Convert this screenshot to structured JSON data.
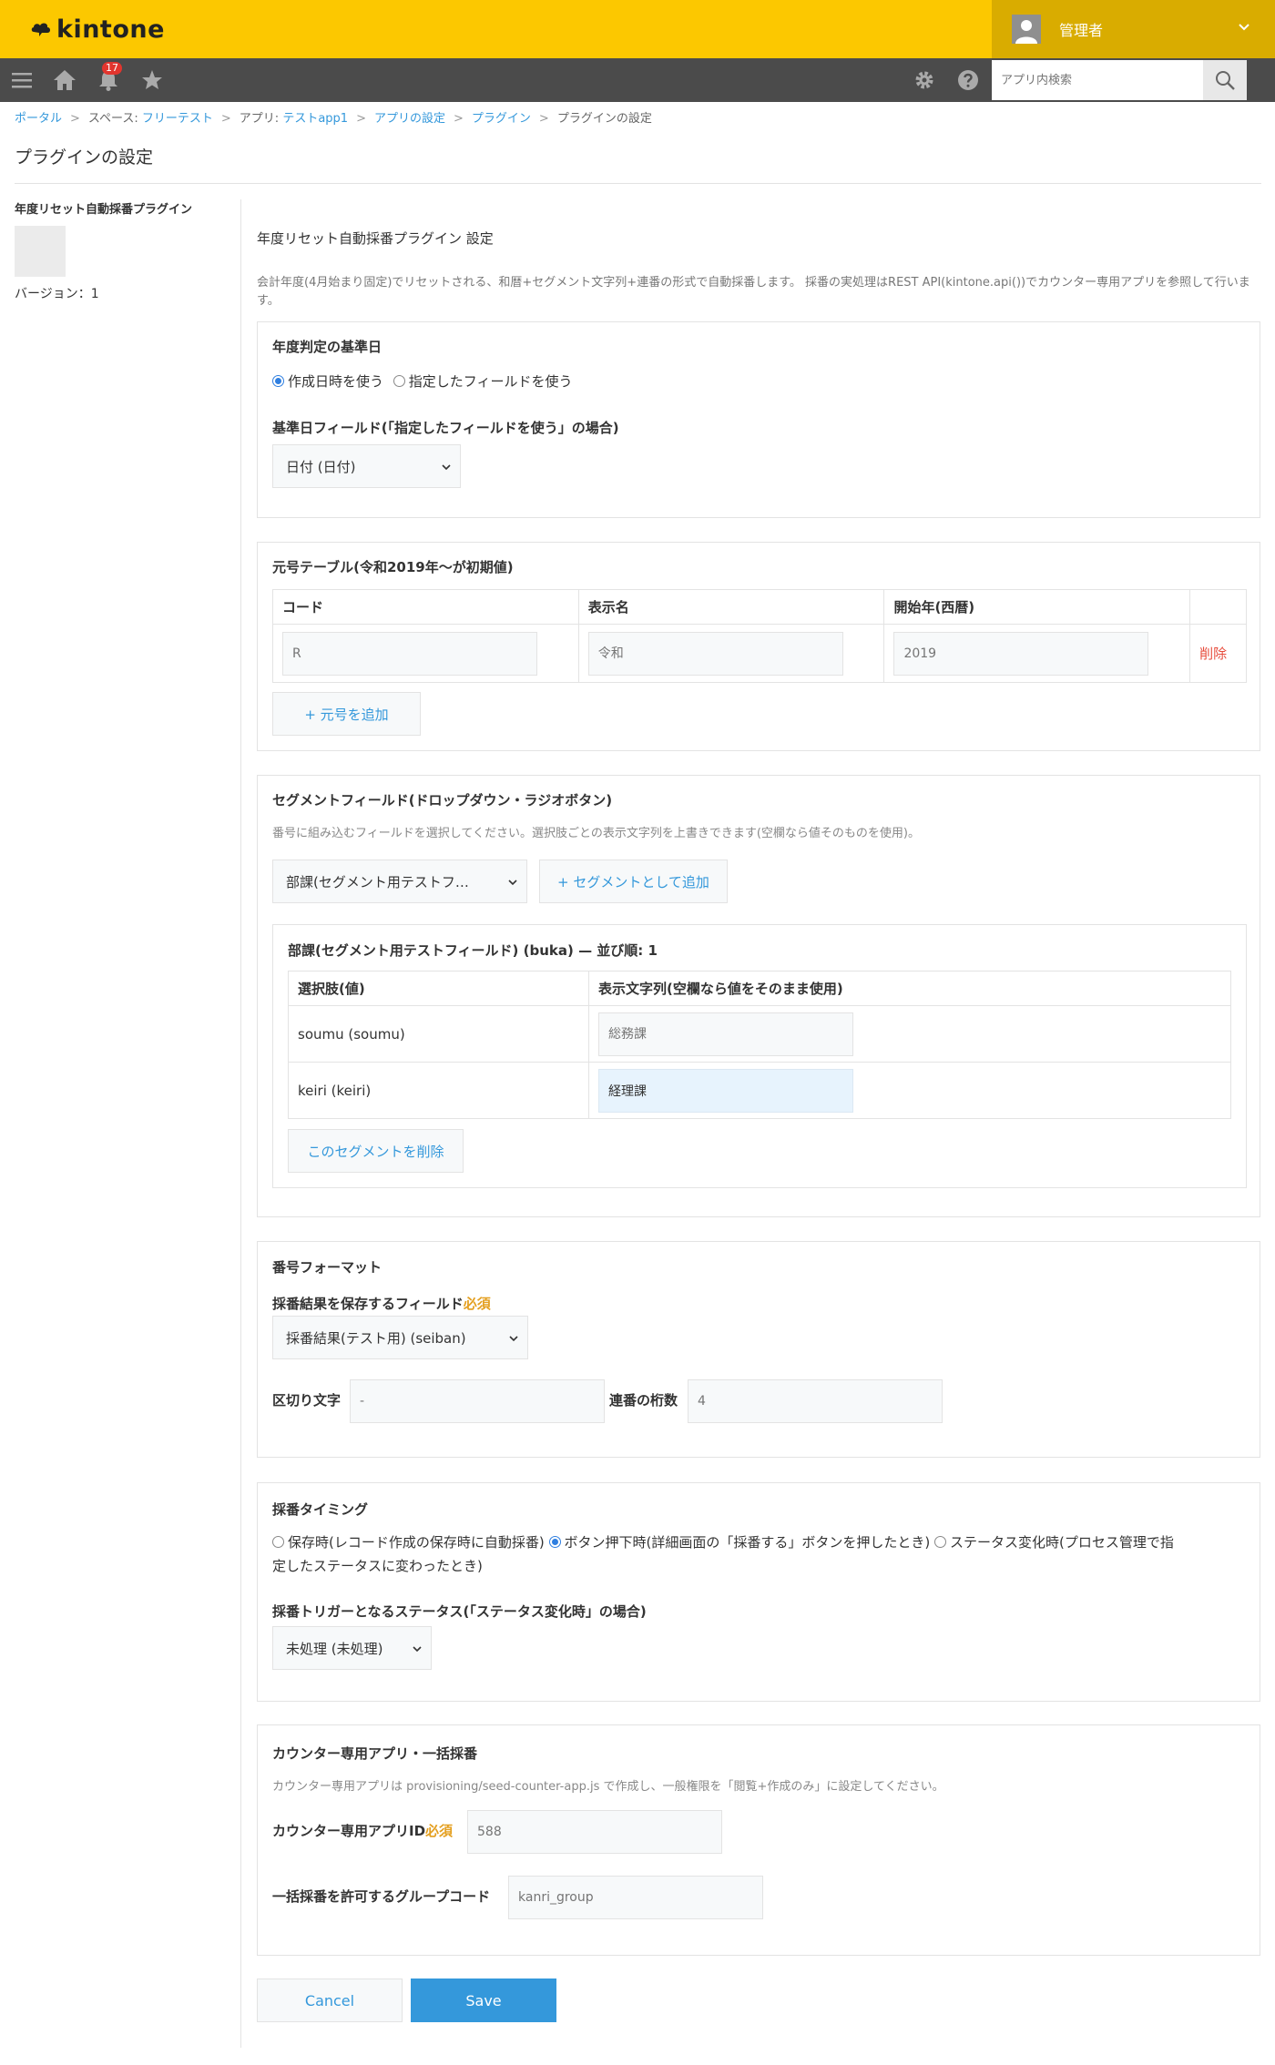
{
  "header": {
    "logo_text": "kintone",
    "user_name": "管理者",
    "notification_count": "17",
    "search_placeholder": "アプリ内検索"
  },
  "breadcrumb": [
    "ポータル",
    "スペース: ",
    "フリーテスト",
    "アプリ: ",
    "テストapp1",
    "アプリの設定",
    "プラグイン",
    "プラグインの設定"
  ],
  "page_title": "プラグインの設定",
  "sidebar": {
    "plugin_name": "年度リセット自動採番プラグイン",
    "version": "バージョン：1"
  },
  "settings": {
    "title": "年度リセット自動採番プラグイン 設定",
    "description": "会計年度(4月始まり固定)でリセットされる、和暦+セグメント文字列+連番の形式で自動採番します。 採番の実処理はREST API(kintone.api())でカウンター専用アプリを参照して行います。"
  },
  "fiscal": {
    "title": "年度判定の基準日",
    "radio_created": "作成日時を使う",
    "radio_field": "指定したフィールドを使う",
    "field_label": "基準日フィールド(「指定したフィールドを使う」の場合)",
    "field_value": "日付 (日付)"
  },
  "era": {
    "title": "元号テーブル(令和2019年〜が初期値)",
    "col_code": "コード",
    "col_name": "表示名",
    "col_year": "開始年(西暦)",
    "row_code": "R",
    "row_name": "令和",
    "row_year": "2019",
    "delete_label": "削除",
    "add_label": "+ 元号を追加"
  },
  "segment": {
    "title": "セグメントフィールド(ドロップダウン・ラジオボタン)",
    "hint": "番号に組み込むフィールドを選択してください。選択肢ごとの表示文字列を上書きできます(空欄なら値そのものを使用)。",
    "select_value": "部課(セグメント用テストフ…",
    "add_label": "+ セグメントとして追加",
    "card_title": "部課(セグメント用テストフィールド) (buka) — 並び順: 1",
    "col_choice": "選択肢(値)",
    "col_display": "表示文字列(空欄なら値をそのまま使用)",
    "rows": [
      {
        "choice": "soumu (soumu)",
        "display": "",
        "placeholder": "総務課"
      },
      {
        "choice": "keiri (keiri)",
        "display": "経理課",
        "placeholder": ""
      }
    ],
    "delete_label": "このセグメントを削除"
  },
  "format": {
    "title": "番号フォーマット",
    "result_label": "採番結果を保存するフィールド",
    "required": "必須",
    "result_value": "採番結果(テスト用) (seiban)",
    "separator_label": "区切り文字",
    "separator_placeholder": "-",
    "digits_label": "連番の桁数",
    "digits_placeholder": "4"
  },
  "timing": {
    "title": "採番タイミング",
    "opt_save": "保存時(レコード作成の保存時に自動採番)",
    "opt_button": "ボタン押下時(詳細画面の「採番する」ボタンを押したとき)",
    "opt_status_1": "ステータス変化時(プロセス管理で指",
    "opt_status_2": "定したステータスに変わったとき)",
    "status_label": "採番トリガーとなるステータス(「ステータス変化時」の場合)",
    "status_value": "未処理 (未処理)"
  },
  "counter": {
    "title": "カウンター専用アプリ・一括採番",
    "hint": "カウンター専用アプリは provisioning/seed-counter-app.js で作成し、一般権限を「閲覧+作成のみ」に設定してください。",
    "app_id_label": "カウンター専用アプリID",
    "required": "必須",
    "app_id_placeholder": "588",
    "group_label": "一括採番を許可するグループコード",
    "group_placeholder": "kanri_group"
  },
  "footer": {
    "cancel_label": "Cancel",
    "save_label": "Save"
  },
  "colors": {
    "header_yellow": "#fcc800",
    "nav_gray": "#4b4b4b",
    "link_blue": "#3498db",
    "save_blue": "#3498db",
    "required_orange": "#e49f1f",
    "delete_red": "#e74c3c"
  }
}
